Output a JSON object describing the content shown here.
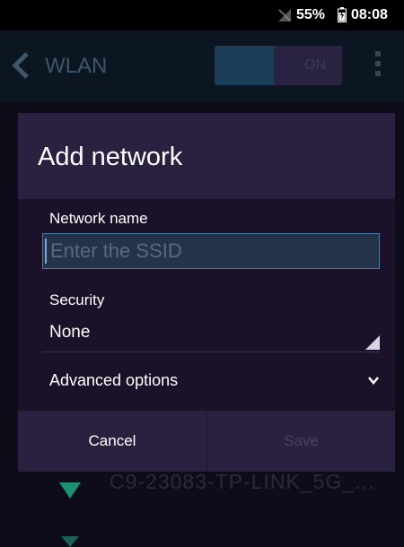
{
  "status_bar": {
    "battery_text": "55%",
    "time": "08:08",
    "signal_icon": "no-sim-icon",
    "battery_icon": "battery-charging-icon"
  },
  "app_bar": {
    "title": "WLAN",
    "toggle_label": "ON"
  },
  "background": {
    "network_name": "C9-23083-TP-LINK_5G_..."
  },
  "dialog": {
    "title": "Add network",
    "ssid_label": "Network name",
    "ssid_placeholder": "Enter the SSID",
    "security_label": "Security",
    "security_value": "None",
    "advanced_label": "Advanced options",
    "cancel_label": "Cancel",
    "save_label": "Save"
  },
  "colors": {
    "dialog_bg": "#1d1530",
    "header_bg": "#2a203f",
    "input_border": "#4b79a6",
    "disabled_text": "#4a4360",
    "accent_green": "#1f8f74"
  }
}
